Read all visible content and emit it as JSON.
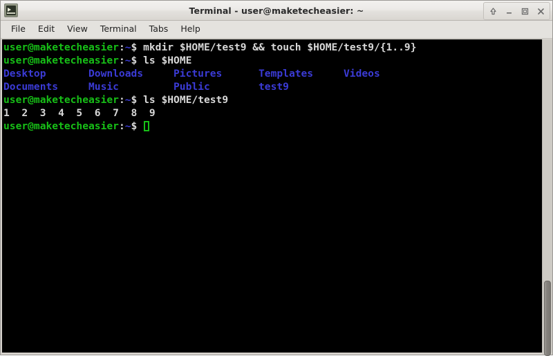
{
  "window": {
    "title": "Terminal - user@maketecheasier: ~",
    "icon": "terminal-icon",
    "controls": [
      {
        "name": "shade-button",
        "glyph": "up-arrow"
      },
      {
        "name": "minimize-button",
        "glyph": "minus"
      },
      {
        "name": "maximize-button",
        "glyph": "square"
      },
      {
        "name": "close-button",
        "glyph": "cross"
      }
    ]
  },
  "menubar": {
    "items": [
      {
        "label": "File"
      },
      {
        "label": "Edit"
      },
      {
        "label": "View"
      },
      {
        "label": "Terminal"
      },
      {
        "label": "Tabs"
      },
      {
        "label": "Help"
      }
    ]
  },
  "terminal": {
    "prompt": {
      "user_host": "user@maketecheasier",
      "colon": ":",
      "path": "~",
      "sigil": "$"
    },
    "lines": [
      {
        "type": "prompt",
        "command": " mkdir $HOME/test9 && touch $HOME/test9/{1..9}"
      },
      {
        "type": "prompt",
        "command": " ls $HOME"
      },
      {
        "type": "output-blue",
        "text": "Desktop       Downloads     Pictures      Templates     Videos"
      },
      {
        "type": "output-blue",
        "text": "Documents     Music         Public        test9"
      },
      {
        "type": "prompt",
        "command": " ls $HOME/test9"
      },
      {
        "type": "output-white",
        "text": "1  2  3  4  5  6  7  8  9"
      },
      {
        "type": "prompt-cursor",
        "command": " "
      }
    ],
    "colors": {
      "background": "#000000",
      "prompt_user": "#17c017",
      "path": "#3b3bd6",
      "directory": "#3b3bd6",
      "file": "#d8d8d8",
      "cursor": "#17c017"
    }
  },
  "scrollbar": {
    "thumb_top_pct": 77,
    "thumb_height_pct": 24
  }
}
